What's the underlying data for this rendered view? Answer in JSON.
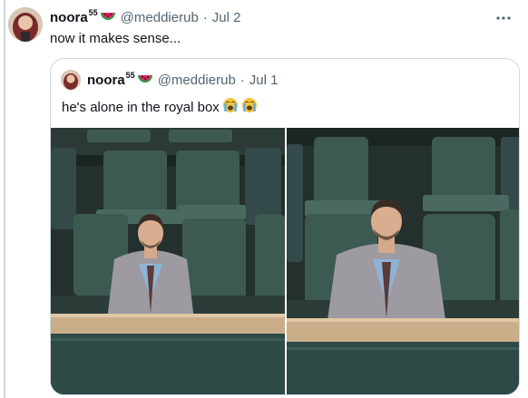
{
  "tweet": {
    "display_name": "noora",
    "name_superscript": "55",
    "handle": "@meddierub",
    "separator": "·",
    "date": "Jul 2",
    "text": "now it makes sense...",
    "more_icon": "more-horizontal-icon",
    "badge_icon": "watermelon-icon"
  },
  "quote": {
    "display_name": "noora",
    "name_superscript": "55",
    "handle": "@meddierub",
    "separator": "·",
    "date": "Jul 1",
    "text": "he's alone in the royal box",
    "emojis": [
      "loudly-crying-face-icon",
      "loudly-crying-face-icon"
    ],
    "badge_icon": "watermelon-icon"
  },
  "colors": {
    "text_primary": "#0f1419",
    "text_secondary": "#536471",
    "border": "#cfd9de",
    "seat_green": "#3d5a52"
  }
}
